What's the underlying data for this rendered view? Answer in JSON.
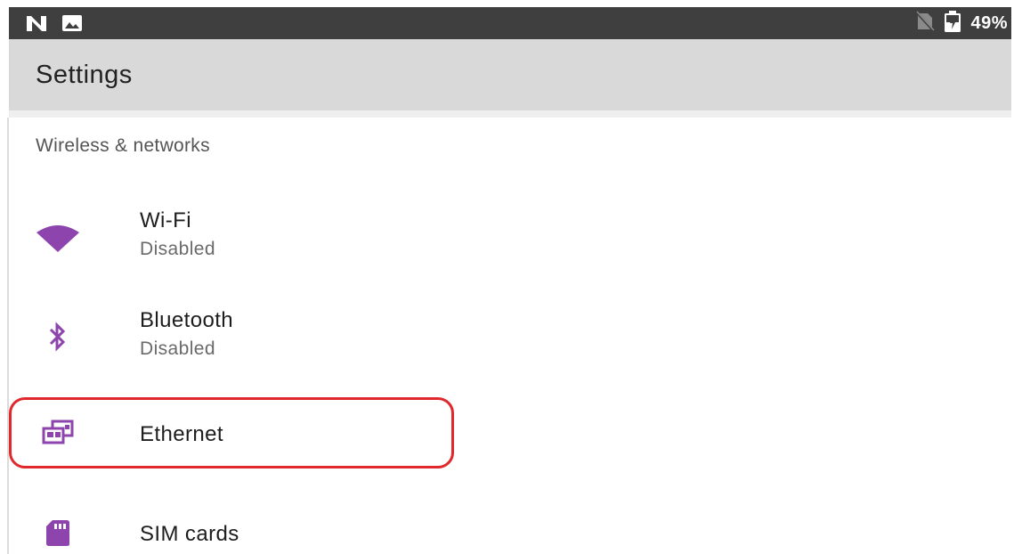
{
  "status_bar": {
    "left_icons": [
      "notification-n-icon",
      "image-notification-icon"
    ],
    "right_icons": [
      "no-sim-icon",
      "battery-charging-icon"
    ],
    "battery": "49%"
  },
  "app_bar": {
    "title": "Settings"
  },
  "section": {
    "header": "Wireless & networks"
  },
  "items": [
    {
      "icon": "wifi-icon",
      "title": "Wi-Fi",
      "summary": "Disabled"
    },
    {
      "icon": "bluetooth-icon",
      "title": "Bluetooth",
      "summary": "Disabled"
    },
    {
      "icon": "ethernet-icon",
      "title": "Ethernet",
      "summary": ""
    },
    {
      "icon": "sim-card-icon",
      "title": "SIM cards",
      "summary": ""
    }
  ],
  "colors": {
    "accent": "#8e44ad",
    "status_bar": "#3f3f3f",
    "app_bar": "#d9d9d9",
    "highlight": "#e0282d"
  }
}
